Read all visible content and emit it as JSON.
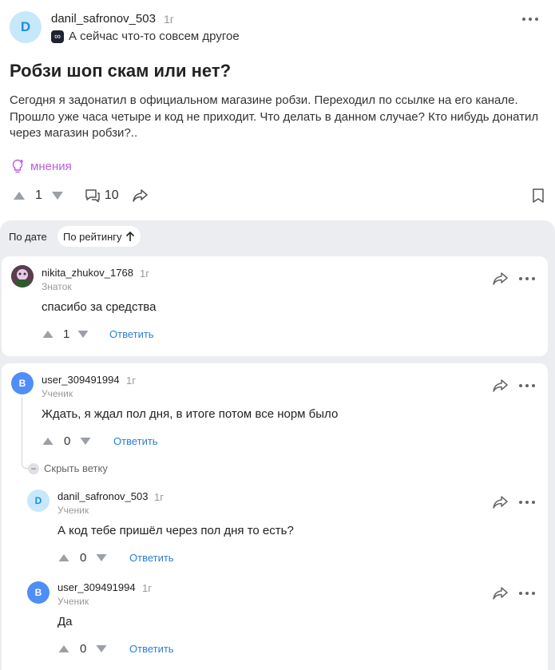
{
  "post": {
    "author_initial": "D",
    "author": "danil_safronov_503",
    "time": "1г",
    "status_icon": "∞",
    "status": "А сейчас что-то совсем другое",
    "title": "Робзи шоп скам или нет?",
    "body": "Сегодня я задонатил в официальном магазине робзи. Переходил по ссылке на его канале. Прошло уже часа четыре и код не приходит. Что делать в данном случае? Кто нибудь донатил через магазин робзи?..",
    "opinions_label": "мнения",
    "votes": "1",
    "comments": "10"
  },
  "sort": {
    "by_date": "По дате",
    "by_rating": "По рейтингу"
  },
  "comments": [
    {
      "author": "nikita_zhukov_1768",
      "time": "1г",
      "role": "Знаток",
      "text": "спасибо за средства",
      "votes": "1",
      "reply": "Ответить"
    },
    {
      "initial": "B",
      "author": "user_309491994",
      "time": "1г",
      "role": "Ученик",
      "text": "Ждать, я ждал пол дня, в итоге потом все норм было",
      "votes": "0",
      "reply": "Ответить",
      "hide_branch": "Скрыть ветку"
    },
    {
      "initial": "D",
      "author": "danil_safronov_503",
      "time": "1г",
      "role": "Ученик",
      "text": "А код тебе пришёл через пол дня то есть?",
      "votes": "0",
      "reply": "Ответить"
    },
    {
      "initial": "B",
      "author": "user_309491994",
      "time": "1г",
      "role": "Ученик",
      "text": "Да",
      "votes": "0",
      "reply": "Ответить"
    }
  ],
  "colors": {
    "accent_blue": "#2a7fd4",
    "opinion_purple": "#c05ce0",
    "avatar_d_bg": "#c6e8fa",
    "avatar_b_bg": "#4f8ef7"
  },
  "icons": [
    "more-icon",
    "infinity-icon",
    "lightbulb-icon",
    "upvote-icon",
    "downvote-icon",
    "comment-icon",
    "share-icon",
    "bookmark-icon",
    "arrow-up-icon",
    "minus-icon"
  ]
}
